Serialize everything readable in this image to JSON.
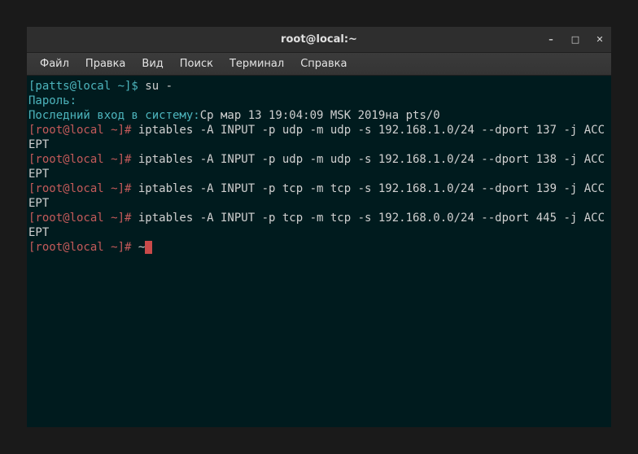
{
  "window": {
    "title": "root@local:~"
  },
  "menu": {
    "file": "Файл",
    "edit": "Правка",
    "view": "Вид",
    "search": "Поиск",
    "terminal": "Терминал",
    "help": "Справка"
  },
  "term": {
    "l1_user_prompt": "[patts@local ~]$ ",
    "l1_cmd": "su -",
    "l2": "Пароль:",
    "l3_label": "Последний вход в систему:",
    "l3_value": "Ср мар 13 19:04:09 MSK 2019на pts/0",
    "root_prompt": "[root@local ~]# ",
    "cmd1": "iptables -A INPUT -p udp -m udp -s 192.168.1.0/24 --dport 137 -j ACCEPT",
    "cmd2": "iptables -A INPUT -p udp -m udp -s 192.168.1.0/24 --dport 138 -j ACCEPT",
    "cmd3": "iptables -A INPUT -p tcp -m tcp -s 192.168.1.0/24 --dport 139 -j ACCEPT",
    "cmd4": "iptables -A INPUT -p tcp -m tcp -s 192.168.0.0/24 --dport 445 -j ACCEPT",
    "current_input": "~"
  }
}
